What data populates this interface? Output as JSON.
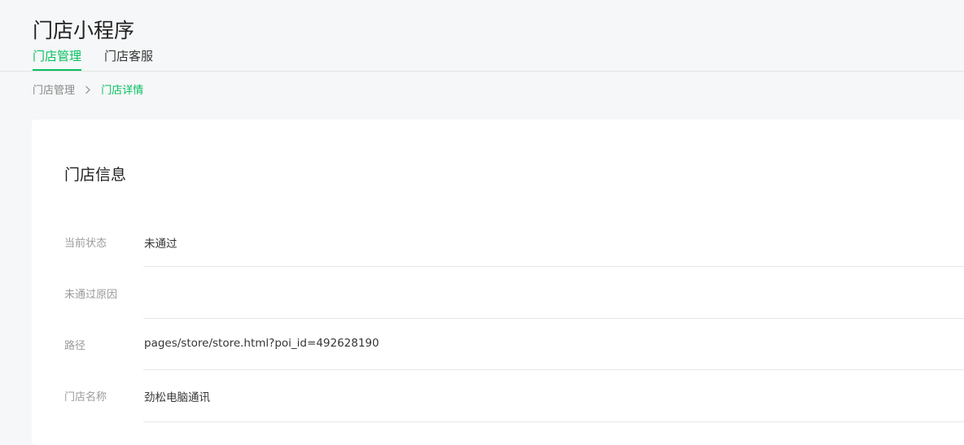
{
  "header": {
    "title": "门店小程序"
  },
  "tabs": [
    {
      "label": "门店管理",
      "active": true
    },
    {
      "label": "门店客服",
      "active": false
    }
  ],
  "breadcrumb": {
    "parent": "门店管理",
    "current": "门店详情",
    "separator_icon": "chevron-right-icon"
  },
  "card": {
    "title": "门店信息",
    "rows": [
      {
        "label": "当前状态",
        "value": "未通过"
      },
      {
        "label": "未通过原因",
        "value": ""
      },
      {
        "label": "路径",
        "value": "pages/store/store.html?poi_id=492628190"
      },
      {
        "label": "门店名称",
        "value": "劲松电脑通讯"
      }
    ]
  },
  "colors": {
    "accent": "#07c160",
    "background": "#f6f7f8",
    "card": "#ffffff"
  }
}
